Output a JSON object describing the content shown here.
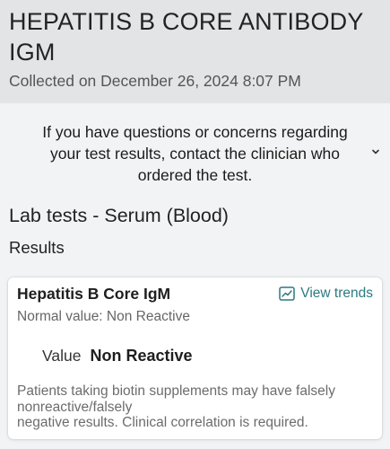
{
  "header": {
    "title_line1": "HEPATITIS B CORE ANTIBODY",
    "title_line2": "IGM",
    "collected": "Collected on December 26, 2024 8:07 PM"
  },
  "notice": {
    "line1": "If you have questions or concerns regarding",
    "line2": "your test results, contact the clinician who",
    "line3": "ordered the test.",
    "expand_icon": "chevron-down-icon"
  },
  "section": {
    "lab_tests": "Lab tests - Serum (Blood)",
    "results": "Results"
  },
  "result_card": {
    "test_name": "Hepatitis B Core IgM",
    "trends_label": "View trends",
    "trends_icon": "trend-chart-icon",
    "normal_value": "Normal value: Non Reactive",
    "value_label": "Value",
    "value": "Non Reactive",
    "note_line1": "Patients taking biotin supplements may have falsely",
    "note_line2": "nonreactive/falsely",
    "note_line3": "negative results. Clinical correlation is required."
  },
  "colors": {
    "header_bg": "#e2e4e6",
    "page_bg": "#f2f3f4",
    "accent": "#2b7a80"
  }
}
